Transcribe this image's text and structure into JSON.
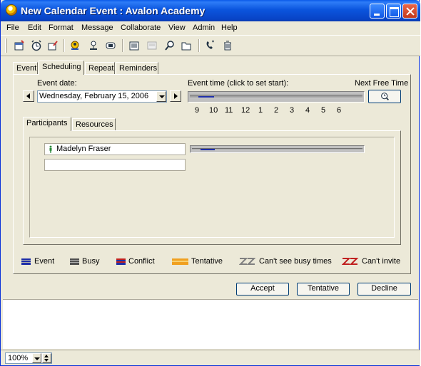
{
  "window": {
    "title": "New Calendar Event : Avalon Academy"
  },
  "menu": [
    "File",
    "Edit",
    "Format",
    "Message",
    "Collaborate",
    "View",
    "Admin",
    "Help"
  ],
  "toolbar": {
    "icons": [
      "new-appointment-icon",
      "alarm-icon",
      "edit-icon",
      "address-book-icon",
      "user-icon",
      "attach-icon",
      "print-icon",
      "print-preview-icon",
      "find-icon",
      "folder-icon",
      "phone-icon",
      "delete-icon"
    ]
  },
  "tabs": [
    "Event",
    "Scheduling",
    "Repeat",
    "Reminders"
  ],
  "scheduling": {
    "event_date_label": "Event date:",
    "event_date_value": "Wednesday, February 15, 2006",
    "event_time_label": "Event time (click to set start):",
    "next_free_time_label": "Next Free Time",
    "hours": [
      "9",
      "10",
      "11",
      "12",
      "1",
      "2",
      "3",
      "4",
      "5",
      "6"
    ],
    "sub_tabs": [
      "Participants",
      "Resources"
    ],
    "participants": [
      {
        "name": "Madelyn Fraser",
        "icon": "person-icon"
      }
    ],
    "new_participant_value": ""
  },
  "legend": [
    {
      "label": "Event",
      "color": "#1f2fa8"
    },
    {
      "label": "Busy",
      "color": "#505050"
    },
    {
      "label": "Conflict",
      "color": "#c02020"
    },
    {
      "label": "Tentative",
      "color": "#f0a020"
    },
    {
      "label": "Can't see busy times",
      "color": "#808080"
    },
    {
      "label": "Can't invite",
      "color": "#c02020"
    }
  ],
  "buttons": {
    "accept": "Accept",
    "tentative": "Tentative",
    "decline": "Decline"
  },
  "status": {
    "zoom": "100%"
  }
}
